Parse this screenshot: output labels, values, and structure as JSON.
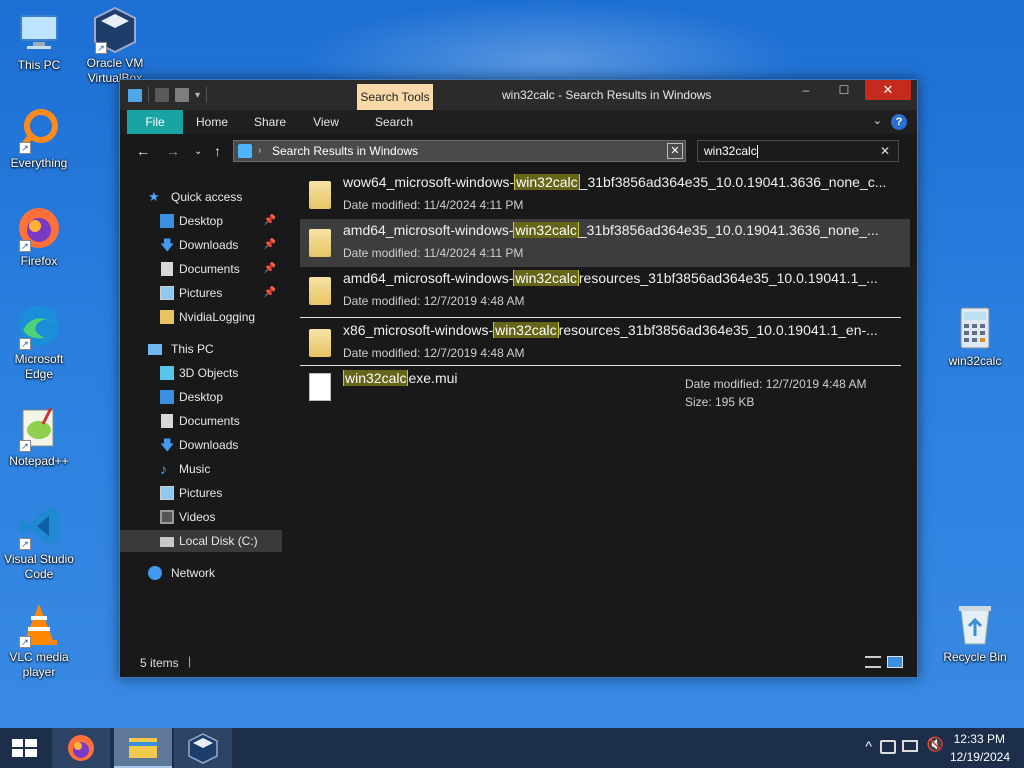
{
  "desktop": {
    "icons": [
      {
        "label": "This PC"
      },
      {
        "label": "Oracle VM VirtualBox"
      },
      {
        "label": "Everything"
      },
      {
        "label": "Firefox"
      },
      {
        "label": "Microsoft Edge"
      },
      {
        "label": "Notepad++"
      },
      {
        "label": "Visual Studio Code"
      },
      {
        "label": "VLC media player"
      },
      {
        "label": "win32calc"
      },
      {
        "label": "Recycle Bin"
      }
    ],
    "icon_names": [
      "this-pc-icon",
      "virtualbox-icon",
      "everything-icon",
      "firefox-icon",
      "edge-icon",
      "notepadpp-icon",
      "vscode-icon",
      "vlc-icon",
      "calculator-icon",
      "recycle-bin-icon"
    ]
  },
  "window": {
    "title": "win32calc - Search Results in Windows",
    "context_tab": "Search Tools",
    "controls": {
      "minimize": "–",
      "maximize": "☐",
      "close": "✕"
    },
    "ribbon_tabs": [
      "File",
      "Home",
      "Share",
      "View",
      "Search"
    ],
    "address": {
      "text": "Search Results in Windows"
    },
    "search": {
      "value": "win32calc"
    }
  },
  "sidebar": {
    "items": [
      {
        "label": "Quick access",
        "icon": "star-icon",
        "pinned": false
      },
      {
        "label": "Desktop",
        "icon": "desktop-icon",
        "pinned": true
      },
      {
        "label": "Downloads",
        "icon": "download-arrow-icon",
        "pinned": true
      },
      {
        "label": "Documents",
        "icon": "document-icon",
        "pinned": true
      },
      {
        "label": "Pictures",
        "icon": "pictures-icon",
        "pinned": true
      },
      {
        "label": "NvidiaLogging",
        "icon": "folder-icon",
        "pinned": false
      },
      {
        "label": "This PC",
        "icon": "computer-icon",
        "pinned": false
      },
      {
        "label": "3D Objects",
        "icon": "cube-icon",
        "pinned": false
      },
      {
        "label": "Desktop",
        "icon": "desktop-icon",
        "pinned": false
      },
      {
        "label": "Documents",
        "icon": "document-icon",
        "pinned": false
      },
      {
        "label": "Downloads",
        "icon": "download-arrow-icon",
        "pinned": false
      },
      {
        "label": "Music",
        "icon": "music-icon",
        "pinned": false
      },
      {
        "label": "Pictures",
        "icon": "pictures-icon",
        "pinned": false
      },
      {
        "label": "Videos",
        "icon": "videos-icon",
        "pinned": false
      },
      {
        "label": "Local Disk (C:)",
        "icon": "drive-icon",
        "pinned": false,
        "selected": true
      },
      {
        "label": "Network",
        "icon": "network-icon",
        "pinned": false
      }
    ]
  },
  "results": [
    {
      "prefix": "wow64_microsoft-windows-",
      "match": "win32calc",
      "suffix": "_31bf3856ad364e35_10.0.19041.3636_none_c...",
      "date": "Date modified: 11/4/2024 4:11 PM",
      "icon": "folder-icon"
    },
    {
      "prefix": "amd64_microsoft-windows-",
      "match": "win32calc",
      "suffix": "_31bf3856ad364e35_10.0.19041.3636_none_...",
      "date": "Date modified: 11/4/2024 4:11 PM",
      "icon": "folder-icon",
      "selected": true
    },
    {
      "prefix": "amd64_microsoft-windows-",
      "match": "win32calc",
      "suffix": "resources_31bf3856ad364e35_10.0.19041.1_...",
      "date": "Date modified: 12/7/2019 4:48 AM",
      "icon": "folder-icon"
    },
    {
      "prefix": "x86_microsoft-windows-",
      "match": "win32calc",
      "suffix": "resources_31bf3856ad364e35_10.0.19041.1_en-...",
      "date": "Date modified: 12/7/2019 4:48 AM",
      "icon": "folder-icon"
    },
    {
      "prefix": "",
      "match": "win32calc",
      "suffix": "exe.mui",
      "date": "Date modified: 12/7/2019 4:48 AM",
      "size": "Size: 195 KB",
      "icon": "file-icon"
    }
  ],
  "status": {
    "count": "5 items"
  },
  "taskbar": {
    "apps": [
      "start-icon",
      "firefox-icon",
      "file-explorer-icon",
      "virtualbox-icon"
    ],
    "time": "12:33 PM",
    "date": "12/19/2024"
  }
}
